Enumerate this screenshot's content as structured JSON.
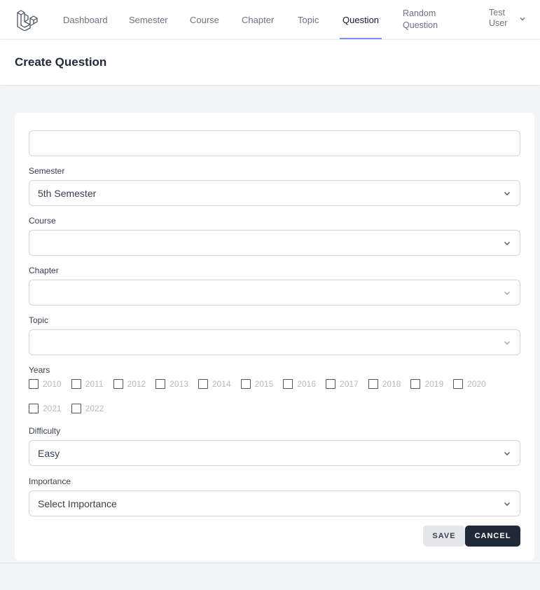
{
  "nav": {
    "links": [
      "Dashboard",
      "Semester",
      "Course",
      "Chapter",
      "Topic",
      "Question"
    ],
    "random_line1": "Random",
    "random_line2": "Question",
    "user_line1": "Test",
    "user_line2": "User",
    "active": "Question",
    "accent": "#818cf8"
  },
  "page": {
    "title": "Create Question"
  },
  "form": {
    "question_value": "",
    "semester_label": "Semester",
    "semester_value": "5th Semester",
    "course_label": "Course",
    "course_value": "",
    "chapter_label": "Chapter",
    "chapter_value": "",
    "topic_label": "Topic",
    "topic_value": "",
    "years_label": "Years",
    "years": [
      "2010",
      "2011",
      "2012",
      "2013",
      "2014",
      "2015",
      "2016",
      "2017",
      "2018",
      "2019",
      "2020",
      "2021",
      "2022"
    ],
    "difficulty_label": "Difficulty",
    "difficulty_value": "Easy",
    "importance_label": "Importance",
    "importance_value": "Select Importance",
    "save_label": "SAVE",
    "cancel_label": "CANCEL"
  },
  "icons": {
    "logo": "laravel-logo-icon",
    "dropdown": "chevron-down-icon"
  }
}
